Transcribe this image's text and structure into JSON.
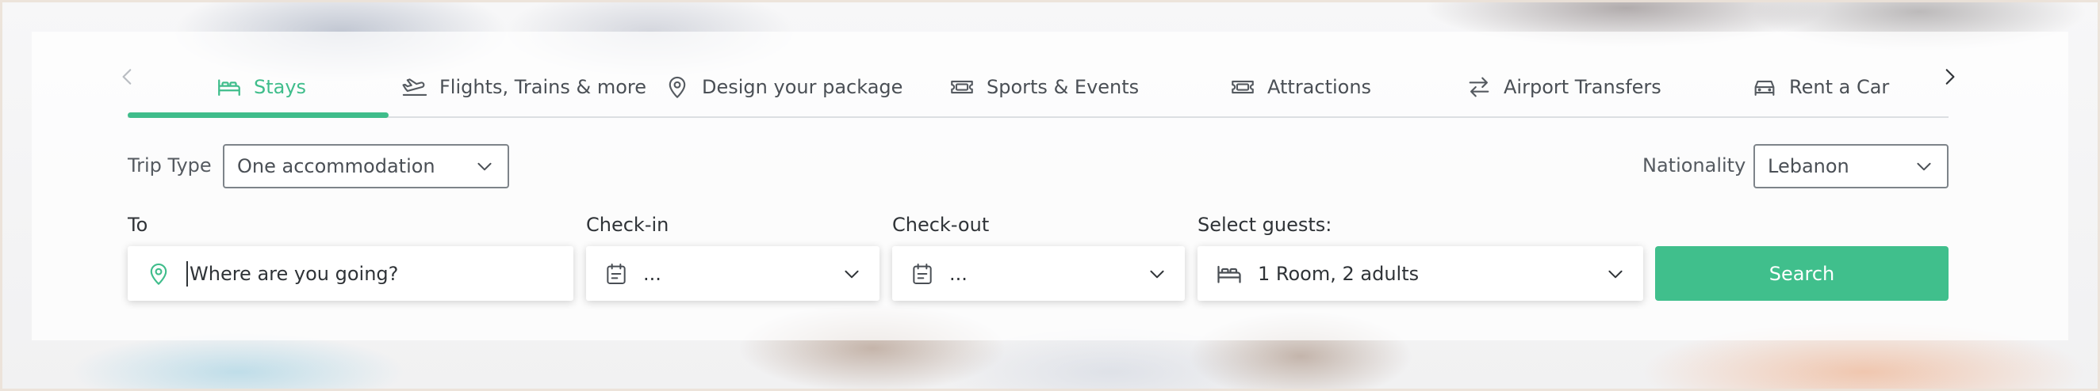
{
  "colors": {
    "accent": "#3fbd8b",
    "search_button": "#40bf8c",
    "text": "#2f3337"
  },
  "tabs": [
    {
      "label": "Stays",
      "icon": "bed-icon",
      "active": true
    },
    {
      "label": "Flights, Trains & more",
      "icon": "plane-icon",
      "active": false
    },
    {
      "label": "Design your package",
      "icon": "location-pin-icon",
      "active": false
    },
    {
      "label": "Sports & Events",
      "icon": "ticket-icon",
      "active": false
    },
    {
      "label": "Attractions",
      "icon": "ticket-icon",
      "active": false
    },
    {
      "label": "Airport Transfers",
      "icon": "transfer-arrows-icon",
      "active": false
    },
    {
      "label": "Rent a Car",
      "icon": "car-icon",
      "active": false
    }
  ],
  "trip_type": {
    "label": "Trip Type",
    "value": "One accommodation"
  },
  "nationality": {
    "label": "Nationality",
    "value": "Lebanon"
  },
  "search_form": {
    "to_label": "To",
    "to_placeholder": "Where are you going?",
    "checkin_label": "Check-in",
    "checkin_value": "...",
    "checkout_label": "Check-out",
    "checkout_value": "...",
    "guests_label": "Select guests:",
    "guests_value": "1 Room, 2 adults",
    "search_label": "Search"
  }
}
